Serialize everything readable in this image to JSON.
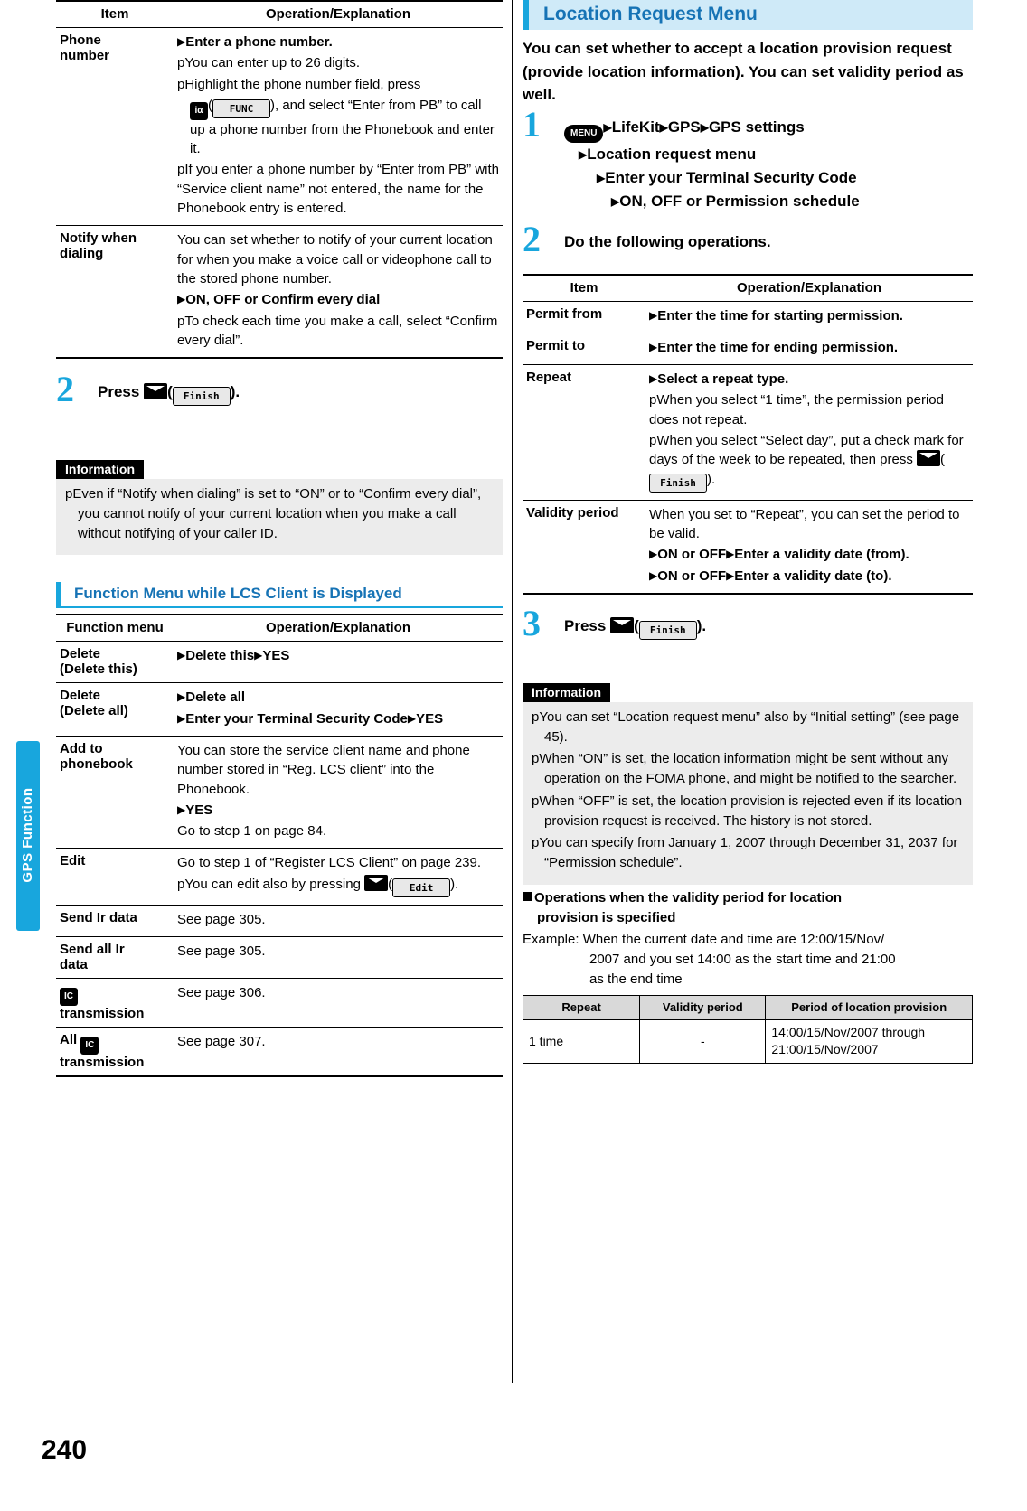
{
  "side_tab": {
    "label": "GPS Function"
  },
  "page_number": "240",
  "left": {
    "table1": {
      "headers": [
        "Item",
        "Operation/Explanation"
      ],
      "rows": [
        {
          "item": "Phone number",
          "lines": [
            {
              "type": "arrow",
              "bold": true,
              "text": "Enter a phone number."
            },
            {
              "type": "bullet",
              "text": "You can enter up to 26 digits."
            },
            {
              "type": "bullet",
              "text": "Highlight the phone number field, press"
            },
            {
              "type": "plain_keys",
              "text_after": "), and select “Enter from PB” to call up a phone number from the Phonebook and enter it.",
              "key_icon": "i-alpha-icon",
              "softkey": "FUNC"
            },
            {
              "type": "bullet",
              "text": "If you enter a phone number by “Enter from PB” with “Service client name” not entered, the name for the Phonebook entry is entered."
            }
          ]
        },
        {
          "item": "Notify when dialing",
          "lines": [
            {
              "type": "plain",
              "text": "You can set whether to notify of your current location for when you make a voice call or videophone call to the stored phone number."
            },
            {
              "type": "arrow",
              "bold": true,
              "text": "ON, OFF or Confirm every dial"
            },
            {
              "type": "bullet",
              "text": "To check each time you make a call, select “Confirm every dial”."
            }
          ]
        }
      ]
    },
    "step2": {
      "number": "2",
      "text_before": "Press",
      "key": "envelope-key",
      "softkey": "Finish",
      "text_after": ")."
    },
    "information": {
      "label": "Information",
      "items": [
        "Even if “Notify when dialing” is set to “ON” or to “Confirm every dial”, you cannot notify of your current location when you make a call without notifying of your caller ID."
      ]
    },
    "section_title": "Function Menu while LCS Client is Displayed",
    "table2": {
      "headers": [
        "Function menu",
        "Operation/Explanation"
      ],
      "rows": [
        {
          "item": "Delete (Delete this)",
          "lines": [
            {
              "type": "arrow",
              "bold": true,
              "text": "Delete this",
              "arrow2": true,
              "text2": "YES"
            }
          ]
        },
        {
          "item": "Delete (Delete all)",
          "lines": [
            {
              "type": "arrow",
              "bold": true,
              "text": "Delete all"
            },
            {
              "type": "arrow",
              "bold": true,
              "text": "Enter your Terminal Security Code",
              "arrow2": true,
              "text2": "YES"
            }
          ]
        },
        {
          "item": "Add to phonebook",
          "lines": [
            {
              "type": "plain",
              "text": "You can store the service client name and phone number stored in “Reg. LCS client” into the Phonebook."
            },
            {
              "type": "arrow",
              "bold": true,
              "text": "YES"
            },
            {
              "type": "plain",
              "text": "Go to step 1 on page 84."
            }
          ]
        },
        {
          "item": "Edit",
          "lines": [
            {
              "type": "plain",
              "text": "Go to step 1 of “Register LCS Client” on page 239."
            },
            {
              "type": "bullet_key",
              "text": "You can edit also by pressing",
              "softkey": "Edit",
              "text_after": ")."
            }
          ]
        },
        {
          "item": "Send Ir data",
          "lines": [
            {
              "type": "plain",
              "text": "See page 305."
            }
          ]
        },
        {
          "item": "Send all Ir data",
          "lines": [
            {
              "type": "plain",
              "text": "See page 305."
            }
          ]
        },
        {
          "item_icon": "ic-icon",
          "item": "transmission",
          "lines": [
            {
              "type": "plain",
              "text": "See page 306."
            }
          ]
        },
        {
          "item_prefix": "All",
          "item_icon": "ic-icon",
          "item": "transmission",
          "lines": [
            {
              "type": "plain",
              "text": "See page 307."
            }
          ]
        }
      ]
    }
  },
  "right": {
    "title": "Location Request Menu",
    "intro": "You can set whether to accept a location provision request (provide location information). You can set validity period as well.",
    "step1": {
      "number": "1",
      "menu_key": "MENU",
      "line1_a": "LifeKit",
      "line1_b": "GPS",
      "line1_c": "GPS settings",
      "line2": "Location request menu",
      "line3": "Enter your Terminal Security Code",
      "line4": "ON, OFF or Permission schedule"
    },
    "step2": {
      "number": "2",
      "text": "Do the following operations."
    },
    "table": {
      "headers": [
        "Item",
        "Operation/Explanation"
      ],
      "rows": [
        {
          "item": "Permit from",
          "lines": [
            {
              "type": "arrow",
              "bold": true,
              "text": "Enter the time for starting permission."
            }
          ]
        },
        {
          "item": "Permit to",
          "lines": [
            {
              "type": "arrow",
              "bold": true,
              "text": "Enter the time for ending permission."
            }
          ]
        },
        {
          "item": "Repeat",
          "lines": [
            {
              "type": "arrow",
              "bold": true,
              "text": "Select a repeat type."
            },
            {
              "type": "bullet",
              "text": "When you select “1 time”, the permission period does not repeat."
            },
            {
              "type": "bullet_key2",
              "text": "When you select “Select day”, put a check mark for days of the week to be repeated, then press",
              "softkey": "Finish",
              "text_after": ")."
            }
          ]
        },
        {
          "item": "Validity period",
          "lines": [
            {
              "type": "plain",
              "text": "When you set to “Repeat”, you can set the period to be valid."
            },
            {
              "type": "arrow",
              "bold": true,
              "text": "ON or OFF",
              "arrow2": true,
              "text2": "Enter a validity date (from)."
            },
            {
              "type": "arrow",
              "bold": true,
              "text": "ON or OFF",
              "arrow2": true,
              "text2": "Enter a validity date (to)."
            }
          ]
        }
      ]
    },
    "step3": {
      "number": "3",
      "text_before": "Press",
      "key": "envelope-key",
      "softkey": "Finish",
      "text_after": ")."
    },
    "information": {
      "label": "Information",
      "items": [
        "You can set “Location request menu” also by “Initial setting” (see page 45).",
        "When “ON” is set, the location information might be sent without any operation on the FOMA phone, and might be notified to the searcher.",
        "When “OFF” is set, the location provision is rejected even if its location provision request is received. The history is not stored.",
        "You can specify from January 1, 2007 through December 31, 2037 for “Permission schedule”."
      ]
    },
    "ops_heading_line1": "Operations when the validity period for location",
    "ops_heading_line2": "provision is specified",
    "example_label": "Example:",
    "example_line1": "When the current date and time are 12:00/15/Nov/",
    "example_line2": "2007 and you set 14:00 as the start time and 21:00",
    "example_line3": "as the end time",
    "grid": {
      "headers": [
        "Repeat",
        "Validity period",
        "Period of location provision"
      ],
      "rows": [
        [
          "1 time",
          "-",
          "14:00/15/Nov/2007 through 21:00/15/Nov/2007"
        ]
      ]
    }
  }
}
